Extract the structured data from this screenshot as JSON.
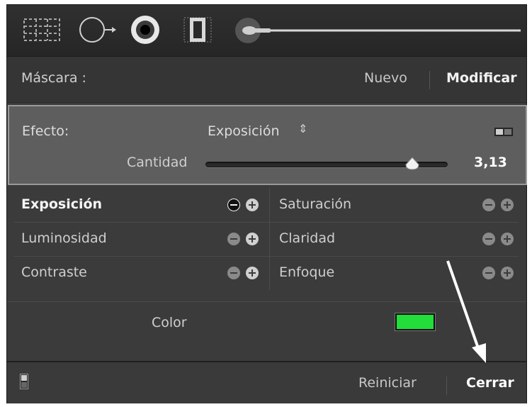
{
  "toolbar": {
    "tools": [
      {
        "icon": "crop-overlay-icon"
      },
      {
        "icon": "spot-removal-icon"
      },
      {
        "icon": "red-eye-icon"
      },
      {
        "icon": "graduated-filter-icon"
      },
      {
        "icon": "adjustment-brush-icon"
      }
    ]
  },
  "mask": {
    "label": "Máscara :",
    "new_label": "Nuevo",
    "modify_label": "Modificar"
  },
  "effect": {
    "label": "Efecto:",
    "selected": "Exposición",
    "selector_arrows": "⇕",
    "amount_label": "Cantidad",
    "amount_value": "3,13",
    "amount_fraction": 0.86
  },
  "adjustments": {
    "left": [
      {
        "name": "Exposición",
        "active": true
      },
      {
        "name": "Luminosidad",
        "active": false
      },
      {
        "name": "Contraste",
        "active": false
      }
    ],
    "right": [
      {
        "name": "Saturación",
        "active": false
      },
      {
        "name": "Claridad",
        "active": false
      },
      {
        "name": "Enfoque",
        "active": false
      }
    ]
  },
  "color": {
    "label": "Color",
    "swatch": "#22dd3a"
  },
  "footer": {
    "reset_label": "Reiniciar",
    "close_label": "Cerrar"
  },
  "colors": {
    "panel_bg": "#3b3b3b",
    "effect_bg": "#5e5e5e",
    "text": "#cfcfcf",
    "annotation_arrow": "#ffffff"
  }
}
